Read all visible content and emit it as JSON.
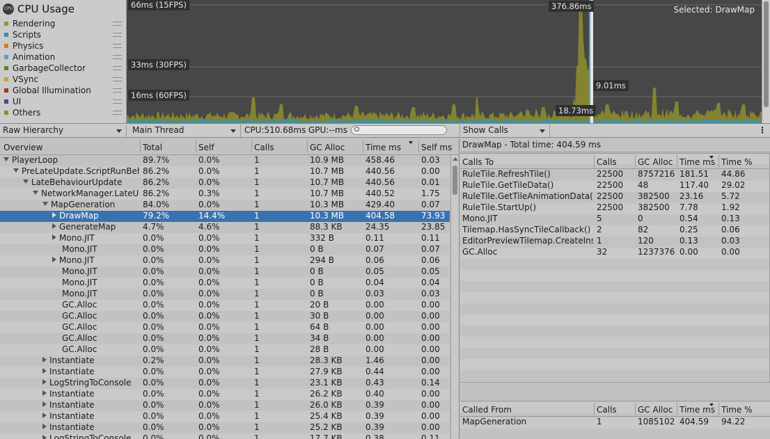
{
  "module": {
    "icon": "cpu-chip-icon",
    "icon_text": "CPU",
    "title": "CPU Usage"
  },
  "legend": [
    {
      "label": "Rendering",
      "color": "#7da132"
    },
    {
      "label": "Scripts",
      "color": "#3d8fa8"
    },
    {
      "label": "Physics",
      "color": "#d17b2b"
    },
    {
      "label": "Animation",
      "color": "#4fa3c2"
    },
    {
      "label": "GarbageCollector",
      "color": "#6e7d2c"
    },
    {
      "label": "VSync",
      "color": "#c8a430"
    },
    {
      "label": "Global Illumination",
      "color": "#9c3a2a"
    },
    {
      "label": "UI",
      "color": "#5a3f91"
    },
    {
      "label": "Others",
      "color": "#8f8e2e"
    }
  ],
  "graph": {
    "lines": [
      "66ms (15FPS)",
      "33ms (30FPS)",
      "16ms (60FPS)"
    ],
    "peak_value": "376.86ms",
    "selected_value": "9.01ms",
    "frame_value": "18.73ms",
    "selected_label": "Selected: DrawMap",
    "series_color": "#8f8e2e"
  },
  "toolbar": {
    "view": "Raw Hierarchy",
    "thread": "Main Thread",
    "cpu": "CPU:510.68ms",
    "gpu": "GPU:--ms",
    "search_placeholder": "",
    "details": "Show Calls",
    "menu": "⋮"
  },
  "tree": {
    "columns": [
      "Overview",
      "Total",
      "Self",
      "Calls",
      "GC Alloc",
      "Time ms",
      "Self ms"
    ],
    "rows": [
      {
        "name": "PlayerLoop",
        "depth": 0,
        "tri": "d",
        "total": "89.7%",
        "self": "0.0%",
        "calls": "1",
        "gc": "10.9 MB",
        "time": "458.46",
        "selfms": "0.03"
      },
      {
        "name": "PreLateUpdate.ScriptRunBeh",
        "depth": 1,
        "tri": "d",
        "total": "86.2%",
        "self": "0.0%",
        "calls": "1",
        "gc": "10.7 MB",
        "time": "440.56",
        "selfms": "0.00"
      },
      {
        "name": "LateBehaviourUpdate",
        "depth": 2,
        "tri": "d",
        "total": "86.2%",
        "self": "0.0%",
        "calls": "1",
        "gc": "10.7 MB",
        "time": "440.56",
        "selfms": "0.01"
      },
      {
        "name": "NetworkManager.LateUp",
        "depth": 3,
        "tri": "d",
        "total": "86.2%",
        "self": "0.3%",
        "calls": "1",
        "gc": "10.7 MB",
        "time": "440.52",
        "selfms": "1.75"
      },
      {
        "name": "MapGeneration",
        "depth": 4,
        "tri": "d",
        "total": "84.0%",
        "self": "0.0%",
        "calls": "1",
        "gc": "10.3 MB",
        "time": "429.40",
        "selfms": "0.07"
      },
      {
        "name": "DrawMap",
        "depth": 5,
        "tri": "r",
        "sel": true,
        "total": "79.2%",
        "self": "14.4%",
        "calls": "1",
        "gc": "10.3 MB",
        "time": "404.58",
        "selfms": "73.93"
      },
      {
        "name": "GenerateMap",
        "depth": 5,
        "tri": "r",
        "total": "4.7%",
        "self": "4.6%",
        "calls": "1",
        "gc": "88.3 KB",
        "time": "24.35",
        "selfms": "23.85"
      },
      {
        "name": "Mono.JIT",
        "depth": 5,
        "tri": "r",
        "total": "0.0%",
        "self": "0.0%",
        "calls": "1",
        "gc": "332 B",
        "time": "0.11",
        "selfms": "0.11"
      },
      {
        "name": "Mono.JIT",
        "depth": 5,
        "tri": "",
        "total": "0.0%",
        "self": "0.0%",
        "calls": "1",
        "gc": "0 B",
        "time": "0.07",
        "selfms": "0.07"
      },
      {
        "name": "Mono.JIT",
        "depth": 5,
        "tri": "r",
        "total": "0.0%",
        "self": "0.0%",
        "calls": "1",
        "gc": "294 B",
        "time": "0.06",
        "selfms": "0.06"
      },
      {
        "name": "Mono.JIT",
        "depth": 5,
        "tri": "",
        "total": "0.0%",
        "self": "0.0%",
        "calls": "1",
        "gc": "0 B",
        "time": "0.05",
        "selfms": "0.05"
      },
      {
        "name": "Mono.JIT",
        "depth": 5,
        "tri": "",
        "total": "0.0%",
        "self": "0.0%",
        "calls": "1",
        "gc": "0 B",
        "time": "0.04",
        "selfms": "0.04"
      },
      {
        "name": "Mono.JIT",
        "depth": 5,
        "tri": "",
        "total": "0.0%",
        "self": "0.0%",
        "calls": "1",
        "gc": "0 B",
        "time": "0.03",
        "selfms": "0.03"
      },
      {
        "name": "GC.Alloc",
        "depth": 5,
        "tri": "",
        "total": "0.0%",
        "self": "0.0%",
        "calls": "1",
        "gc": "20 B",
        "time": "0.00",
        "selfms": "0.00"
      },
      {
        "name": "GC.Alloc",
        "depth": 5,
        "tri": "",
        "total": "0.0%",
        "self": "0.0%",
        "calls": "1",
        "gc": "30 B",
        "time": "0.00",
        "selfms": "0.00"
      },
      {
        "name": "GC.Alloc",
        "depth": 5,
        "tri": "",
        "total": "0.0%",
        "self": "0.0%",
        "calls": "1",
        "gc": "64 B",
        "time": "0.00",
        "selfms": "0.00"
      },
      {
        "name": "GC.Alloc",
        "depth": 5,
        "tri": "",
        "total": "0.0%",
        "self": "0.0%",
        "calls": "1",
        "gc": "34 B",
        "time": "0.00",
        "selfms": "0.00"
      },
      {
        "name": "GC.Alloc",
        "depth": 5,
        "tri": "",
        "total": "0.0%",
        "self": "0.0%",
        "calls": "1",
        "gc": "28 B",
        "time": "0.00",
        "selfms": "0.00"
      },
      {
        "name": "Instantiate",
        "depth": 4,
        "tri": "r",
        "total": "0.2%",
        "self": "0.0%",
        "calls": "1",
        "gc": "28.3 KB",
        "time": "1.46",
        "selfms": "0.00"
      },
      {
        "name": "Instantiate",
        "depth": 4,
        "tri": "r",
        "total": "0.0%",
        "self": "0.0%",
        "calls": "1",
        "gc": "27.9 KB",
        "time": "0.44",
        "selfms": "0.00"
      },
      {
        "name": "LogStringToConsole",
        "depth": 4,
        "tri": "r",
        "total": "0.0%",
        "self": "0.0%",
        "calls": "1",
        "gc": "23.1 KB",
        "time": "0.43",
        "selfms": "0.14"
      },
      {
        "name": "Instantiate",
        "depth": 4,
        "tri": "r",
        "total": "0.0%",
        "self": "0.0%",
        "calls": "1",
        "gc": "26.2 KB",
        "time": "0.40",
        "selfms": "0.00"
      },
      {
        "name": "Instantiate",
        "depth": 4,
        "tri": "r",
        "total": "0.0%",
        "self": "0.0%",
        "calls": "1",
        "gc": "26.0 KB",
        "time": "0.39",
        "selfms": "0.00"
      },
      {
        "name": "Instantiate",
        "depth": 4,
        "tri": "r",
        "total": "0.0%",
        "self": "0.0%",
        "calls": "1",
        "gc": "25.4 KB",
        "time": "0.39",
        "selfms": "0.00"
      },
      {
        "name": "Instantiate",
        "depth": 4,
        "tri": "r",
        "total": "0.0%",
        "self": "0.0%",
        "calls": "1",
        "gc": "25.2 KB",
        "time": "0.39",
        "selfms": "0.00"
      },
      {
        "name": "LogStringToConsole",
        "depth": 4,
        "tri": "r",
        "total": "0.0%",
        "self": "0.0%",
        "calls": "1",
        "gc": "17.7 KB",
        "time": "0.38",
        "selfms": "0.11"
      }
    ]
  },
  "details": {
    "title": "DrawMap - Total time: 404.59 ms",
    "calls_to": {
      "columns": [
        "Calls To",
        "Calls",
        "GC Alloc",
        "Time ms",
        "Time %"
      ],
      "rows": [
        {
          "name": "RuleTile.RefreshTile()",
          "calls": "22500",
          "gc": "8757216",
          "time": "181.51",
          "pct": "44.86"
        },
        {
          "name": "RuleTile.GetTileData()",
          "calls": "22500",
          "gc": "48",
          "time": "117.40",
          "pct": "29.02"
        },
        {
          "name": "RuleTile.GetTileAnimationData()",
          "calls": "22500",
          "gc": "382500",
          "time": "23.16",
          "pct": "5.72"
        },
        {
          "name": "RuleTile.StartUp()",
          "calls": "22500",
          "gc": "382500",
          "time": "7.78",
          "pct": "1.92"
        },
        {
          "name": "Mono.JIT",
          "calls": "5",
          "gc": "0",
          "time": "0.54",
          "pct": "0.13"
        },
        {
          "name": "Tilemap.HasSyncTileCallback()",
          "calls": "2",
          "gc": "82",
          "time": "0.25",
          "pct": "0.06"
        },
        {
          "name": "EditorPreviewTilemap.CreateInsta",
          "calls": "1",
          "gc": "120",
          "time": "0.13",
          "pct": "0.03"
        },
        {
          "name": "GC.Alloc",
          "calls": "32",
          "gc": "1237376",
          "time": "0.00",
          "pct": "0.00"
        }
      ]
    },
    "called_from": {
      "columns": [
        "Called From",
        "Calls",
        "GC Alloc",
        "Time ms",
        "Time %"
      ],
      "rows": [
        {
          "name": "MapGeneration",
          "calls": "1",
          "gc": "1085102",
          "time": "404.59",
          "pct": "94.22"
        }
      ]
    }
  }
}
